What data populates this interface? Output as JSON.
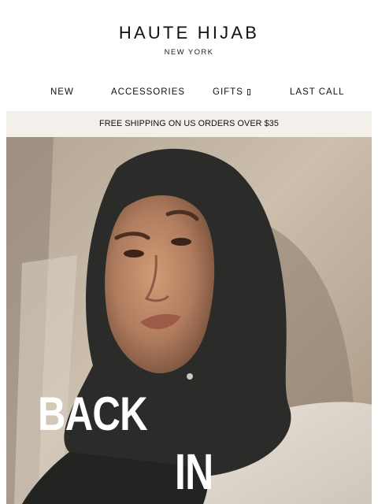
{
  "brand": {
    "name": "HAUTE HIJAB",
    "location": "NEW YORK"
  },
  "nav": {
    "items": [
      {
        "label": "NEW"
      },
      {
        "label": "ACCESSORIES"
      },
      {
        "label": "GIFTS"
      },
      {
        "label": "LAST CALL"
      }
    ]
  },
  "promo": {
    "text": "FREE SHIPPING ON US ORDERS OVER $35"
  },
  "hero": {
    "line1": "BACK",
    "line2": "IN"
  },
  "colors": {
    "promo_bg": "#f3efea",
    "hijab": "#2b2c2a",
    "skin": "#b07c5e",
    "backdrop": "#c9bba7"
  }
}
